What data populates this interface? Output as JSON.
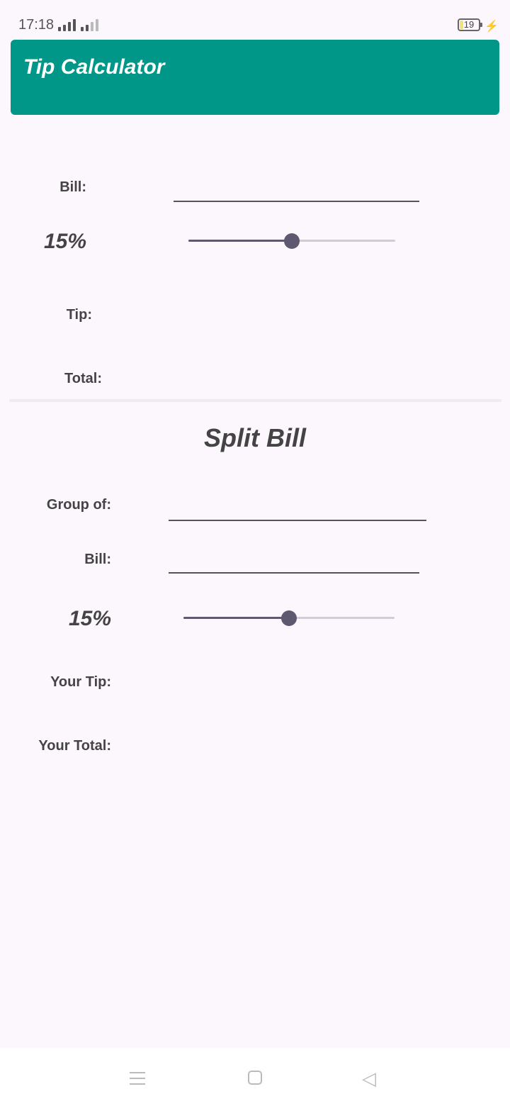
{
  "status_bar": {
    "time": "17:18",
    "battery": "19"
  },
  "app_bar": {
    "title": "Tip Calculator"
  },
  "tip": {
    "bill_label": "Bill:",
    "bill_value": "",
    "percent_label": "15%",
    "percent_value": 15,
    "tip_label": "Tip:",
    "tip_value": "",
    "total_label": "Total:",
    "total_value": ""
  },
  "split": {
    "title": "Split Bill",
    "group_label": "Group of:",
    "group_value": "",
    "bill_label": "Bill:",
    "bill_value": "",
    "percent_label": "15%",
    "percent_value": 15,
    "your_tip_label": "Your Tip:",
    "your_tip_value": "",
    "your_total_label": "Your Total:",
    "your_total_value": ""
  },
  "colors": {
    "accent": "#009688",
    "slider": "#5e5870",
    "background": "#fcf7fd"
  },
  "icons": {
    "nav_menu": "menu-icon",
    "nav_home": "home-icon",
    "nav_back": "back-icon"
  }
}
